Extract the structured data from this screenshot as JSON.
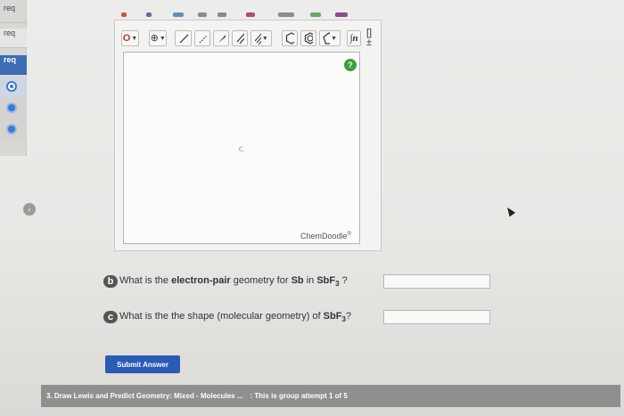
{
  "sidebar": {
    "items": [
      {
        "label": "req"
      },
      {
        "label": "req"
      },
      {
        "label": "req"
      }
    ]
  },
  "chemdoodle": {
    "toolbar": {
      "erase_label": "O",
      "charge_label": "⊕",
      "template_label": "∫n",
      "bracket_label": "[]±"
    },
    "canvas_atom": "C",
    "brand": "ChemDoodle",
    "brand_mark": "®",
    "help": "?"
  },
  "questions": [
    {
      "marker": "b",
      "text_before": "What is the ",
      "bold": "electron-pair",
      "text_mid": " geometry for ",
      "element": "Sb",
      "text_in": " in ",
      "formula_main": "SbF",
      "formula_sub": "3",
      "text_after": " ?",
      "answer_value": ""
    },
    {
      "marker": "c",
      "text_before": "What is the the shape (molecular geometry) of ",
      "formula_main": "SbF",
      "formula_sub": "3",
      "text_after": "?",
      "answer_value": ""
    }
  ],
  "submit_label": "Submit Answer",
  "footer": {
    "title": "3. Draw Lewis and Predict Geometry: Mixed - Molecules ...",
    "status": ": This is group attempt 1 of 5"
  },
  "colors": {
    "accent": "#2a5bb5",
    "help_green": "#3aa13a",
    "footer_bg": "#8f8f8d"
  }
}
